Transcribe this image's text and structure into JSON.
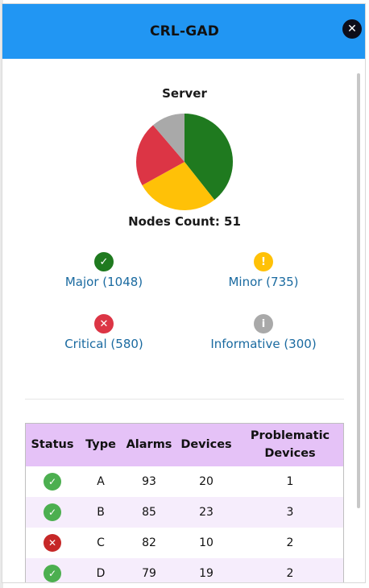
{
  "header": {
    "title": "CRL-GAD",
    "close_label": "✕"
  },
  "section_title": "Server",
  "nodes_count_label": "Nodes Count: 51",
  "chart_data": {
    "type": "pie",
    "slices": [
      {
        "name": "Major",
        "value": 1048,
        "color": "#1f7a1f"
      },
      {
        "name": "Minor",
        "value": 735,
        "color": "#ffc107"
      },
      {
        "name": "Critical",
        "value": 580,
        "color": "#dc3545"
      },
      {
        "name": "Informative",
        "value": 300,
        "color": "#a9a9a9"
      }
    ]
  },
  "legend": [
    {
      "label": "Major (1048)",
      "icon": "check-icon",
      "glyph": "✓",
      "color": "#1f7a1f"
    },
    {
      "label": "Minor (735)",
      "icon": "exclamation-icon",
      "glyph": "!",
      "color": "#ffc107"
    },
    {
      "label": "Critical (580)",
      "icon": "x-icon",
      "glyph": "✕",
      "color": "#dc3545"
    },
    {
      "label": "Informative (300)",
      "icon": "info-icon",
      "glyph": "i",
      "color": "#a9a9a9"
    }
  ],
  "table": {
    "headers": [
      "Status",
      "Type",
      "Alarms",
      "Devices",
      "Problematic Devices"
    ],
    "rows": [
      {
        "status": "ok",
        "status_glyph": "✓",
        "status_color": "#4caf50",
        "type": "A",
        "alarms": "93",
        "devices": "20",
        "problematic": "1"
      },
      {
        "status": "ok",
        "status_glyph": "✓",
        "status_color": "#4caf50",
        "type": "B",
        "alarms": "85",
        "devices": "23",
        "problematic": "3"
      },
      {
        "status": "error",
        "status_glyph": "✕",
        "status_color": "#c62828",
        "type": "C",
        "alarms": "82",
        "devices": "10",
        "problematic": "2"
      },
      {
        "status": "ok",
        "status_glyph": "✓",
        "status_color": "#4caf50",
        "type": "D",
        "alarms": "79",
        "devices": "19",
        "problematic": "2"
      }
    ]
  }
}
